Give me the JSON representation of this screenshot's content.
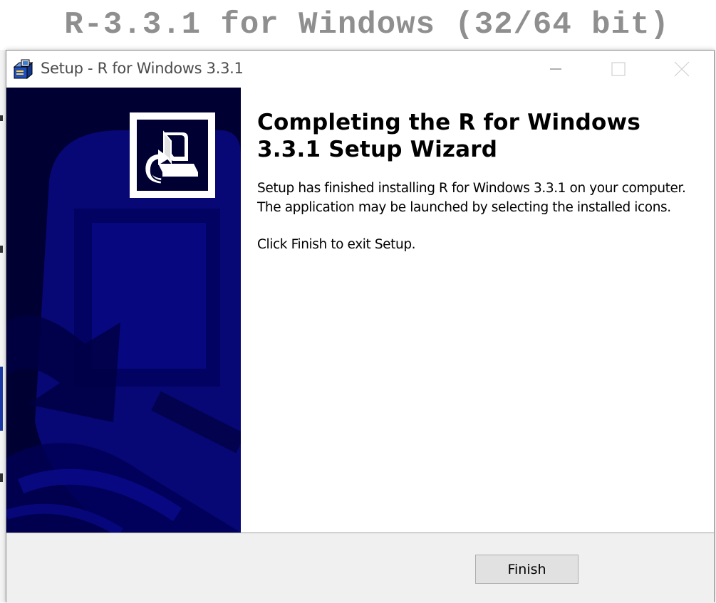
{
  "page": {
    "heading": "R-3.3.1 for Windows (32/64 bit)"
  },
  "window": {
    "title": "Setup - R for Windows 3.3.1",
    "app_icon": "installer-box-icon",
    "controls": {
      "minimize": "minimize-icon",
      "maximize": "maximize-icon",
      "close": "close-icon"
    }
  },
  "wizard": {
    "heading": "Completing the R for Windows 3.3.1 Setup Wizard",
    "paragraph1": "Setup has finished installing R for Windows 3.3.1 on your computer. The application may be launched by selecting the installed icons.",
    "paragraph2": "Click Finish to exit Setup.",
    "logo_icon": "computer-install-icon",
    "banner_colors": {
      "dark": "#000033",
      "blue": "#0a0a8c"
    }
  },
  "footer": {
    "finish_label": "Finish"
  }
}
